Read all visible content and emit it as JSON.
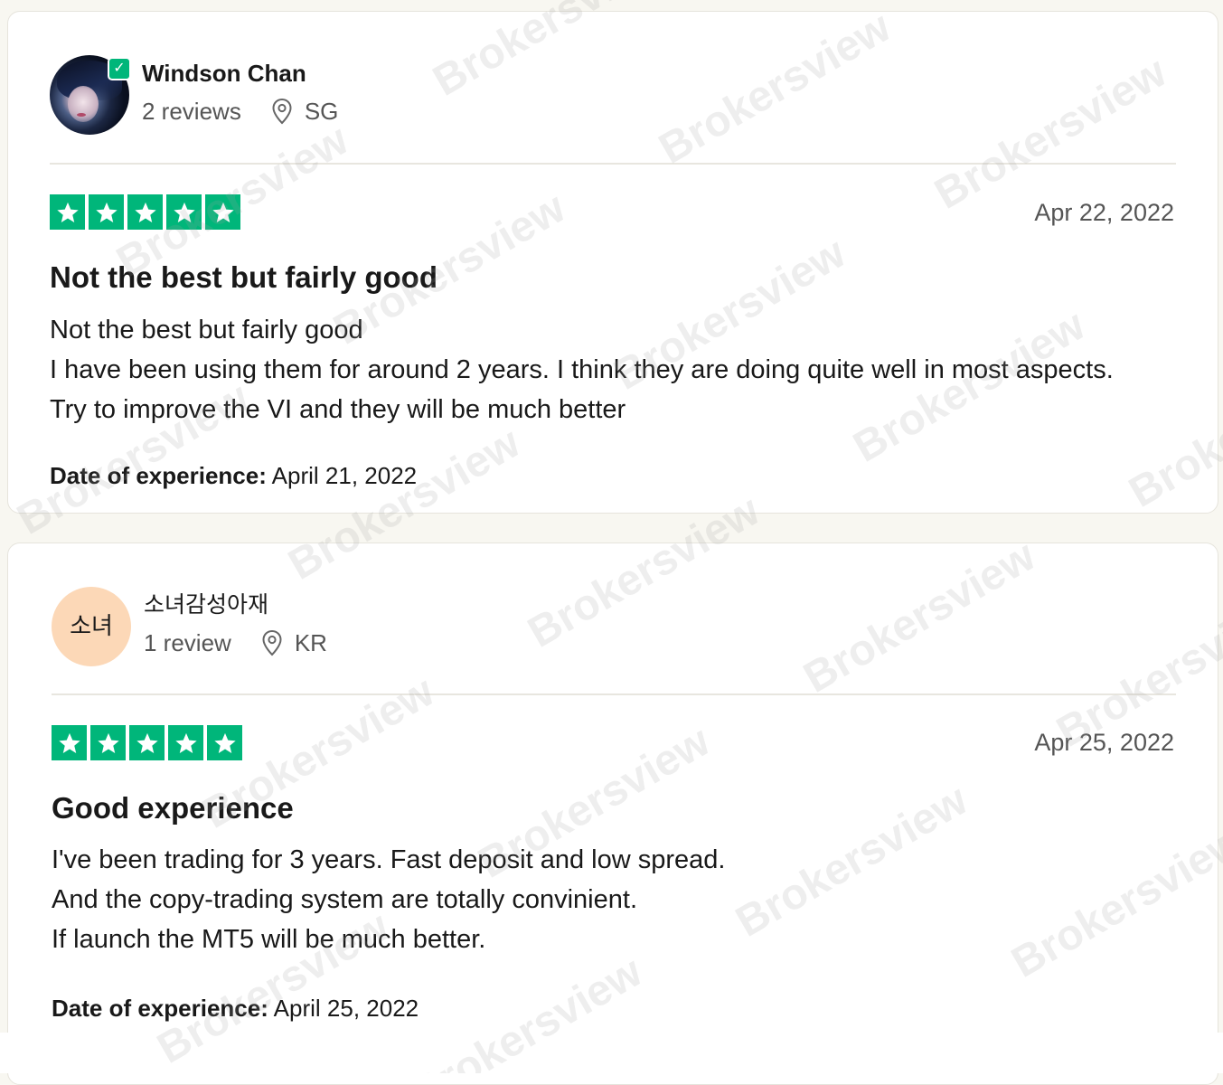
{
  "reviews": [
    {
      "user": {
        "name": "Windson Chan",
        "reviews_count": "2 reviews",
        "country": "SG",
        "verified": true,
        "avatar_type": "photo"
      },
      "rating": 5,
      "date": "Apr 22, 2022",
      "title": "Not the best but fairly good",
      "body": [
        "Not the best but fairly good",
        "I have been using them for around 2 years. I think they are doing quite well in most aspects. Try to improve the VI and they will be much better"
      ],
      "experience_label": "Date of experience:",
      "experience_date": "April 21, 2022"
    },
    {
      "user": {
        "name": "소녀감성아재",
        "initials": "소녀",
        "reviews_count": "1 review",
        "country": "KR",
        "avatar_color": "#fcd8b7",
        "avatar_type": "initials"
      },
      "rating": 5,
      "date": "Apr 25, 2022",
      "title": "Good experience",
      "body": [
        "I've been trading for 3 years. Fast deposit and low spread.",
        "And the copy-trading system are totally convinient.",
        "If launch the MT5 will be much better."
      ],
      "experience_label": "Date of experience:",
      "experience_date": "April 25, 2022"
    }
  ],
  "icons": {
    "location": "location-pin-icon",
    "star": "star-icon",
    "verified": "verified-check-icon"
  },
  "colors": {
    "star_green": "#00b67a",
    "page_bg": "#f8f7f1",
    "card_bg": "#ffffff",
    "muted_text": "#555555"
  },
  "watermark": "Brokersview"
}
